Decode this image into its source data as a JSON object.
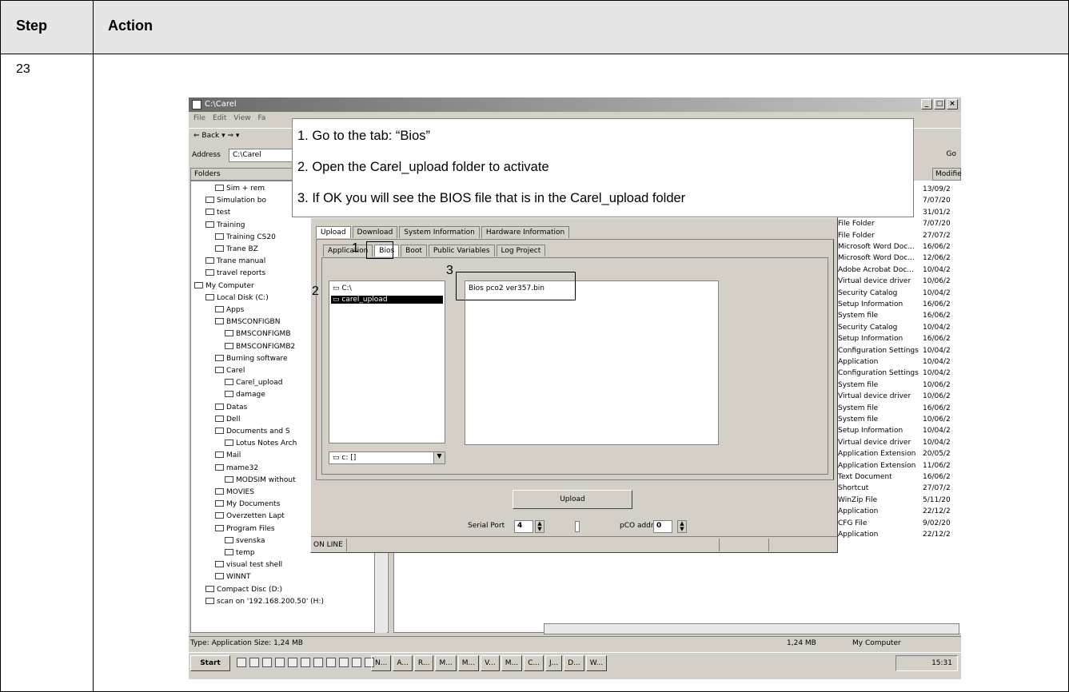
{
  "doc": {
    "headers": {
      "step": "Step",
      "action": "Action"
    },
    "step_number": "23"
  },
  "window": {
    "title": "C:\\Carel",
    "menu": [
      "File",
      "Edit",
      "View",
      "Fa"
    ],
    "toolbar_back": "⇐ Back ▾ ⇒ ▾",
    "address_label": "Address",
    "address_value": "C:\\Carel",
    "go_label": "Go",
    "folders_label": "Folders",
    "modified_label": "Modified"
  },
  "tree": [
    "Sim + rem",
    "Simulation bo",
    "test",
    "Training",
    "Training CS20",
    "Trane BZ",
    "Trane manual",
    "travel reports",
    "My Computer",
    "Local Disk (C:)",
    "Apps",
    "BMSCONFIGBN",
    "BMSCONFIGMB",
    "BMSCONFIGMB2",
    "Burning software",
    "Carel",
    "Carel_upload",
    "damage",
    "Datas",
    "Dell",
    "Documents and S",
    "Lotus Notes Arch",
    "Mail",
    "mame32",
    "MODSIM without",
    "MOVIES",
    "My Documents",
    "Overzetten Lapt",
    "Program Files",
    "svenska",
    "temp",
    "visual test shell",
    "WINNT",
    "Compact Disc (D:)",
    "scan on '192.168.200.50' (H:)"
  ],
  "files": [
    {
      "type": "",
      "date": "13/09/2"
    },
    {
      "type": "",
      "date": "7/07/20"
    },
    {
      "type": "",
      "date": "31/01/2"
    },
    {
      "type": "File Folder",
      "date": "7/07/20"
    },
    {
      "type": "File Folder",
      "date": "27/07/2"
    },
    {
      "type": "Microsoft Word Doc...",
      "date": "16/06/2"
    },
    {
      "type": "Microsoft Word Doc...",
      "date": "12/06/2"
    },
    {
      "type": "Adobe Acrobat Doc...",
      "date": "10/04/2"
    },
    {
      "type": "Virtual device driver",
      "date": "10/06/2"
    },
    {
      "type": "Security Catalog",
      "date": "10/04/2"
    },
    {
      "type": "Setup Information",
      "date": "16/06/2"
    },
    {
      "type": "System file",
      "date": "16/06/2"
    },
    {
      "type": "Security Catalog",
      "date": "10/04/2"
    },
    {
      "type": "Setup Information",
      "date": "16/06/2"
    },
    {
      "type": "Configuration Settings",
      "date": "10/04/2"
    },
    {
      "type": "Application",
      "date": "10/04/2"
    },
    {
      "type": "Configuration Settings",
      "date": "10/04/2"
    },
    {
      "type": "System file",
      "date": "10/06/2"
    },
    {
      "type": "Virtual device driver",
      "date": "10/06/2"
    },
    {
      "type": "System file",
      "date": "16/06/2"
    },
    {
      "type": "System file",
      "date": "10/06/2"
    },
    {
      "type": "Setup Information",
      "date": "10/04/2"
    },
    {
      "type": "Virtual device driver",
      "date": "10/04/2"
    },
    {
      "type": "Application Extension",
      "date": "20/05/2"
    },
    {
      "type": "Application Extension",
      "date": "11/06/2"
    },
    {
      "type": "Text Document",
      "date": "16/06/2"
    },
    {
      "type": "Shortcut",
      "date": "27/07/2"
    },
    {
      "type": "WinZip File",
      "date": "5/11/20"
    },
    {
      "type": "Application",
      "date": "22/12/2"
    },
    {
      "type": "CFG File",
      "date": "9/02/20"
    },
    {
      "type": "Application",
      "date": "22/12/2"
    }
  ],
  "dialog": {
    "tabs_top": [
      "Upload",
      "Download",
      "System Information",
      "Hardware Information"
    ],
    "tabs_sub": [
      "Application",
      "Bios",
      "Boot",
      "Public Variables",
      "Log Project"
    ],
    "dir_root": "C:\\",
    "dir_selected": "carel_upload",
    "drive": "c: []",
    "file_item": "Bios pco2 ver357.bin",
    "upload_label": "Upload",
    "serial_port_label": "Serial Port",
    "serial_port_value": "4",
    "pco_address_label": "pCO address",
    "pco_address_value": "0",
    "status": "ON LINE"
  },
  "instructions": [
    "1.  Go to the tab: “Bios”",
    "2.  Open the Carel_upload folder to activate",
    "3.  If OK you will see the BIOS file that is in the Carel_upload folder"
  ],
  "markers": {
    "m1": "1",
    "m2": "2",
    "m3": "3"
  },
  "statusbar": {
    "left": "Type: Application Size: 1,24 MB",
    "size": "1,24 MB",
    "zone": "My Computer"
  },
  "taskbar": {
    "start": "Start",
    "tasks": [
      "N...",
      "A...",
      "R...",
      "M...",
      "M...",
      "V...",
      "M...",
      "C...",
      "J...",
      "D...",
      "W..."
    ],
    "clock": "15:31"
  }
}
